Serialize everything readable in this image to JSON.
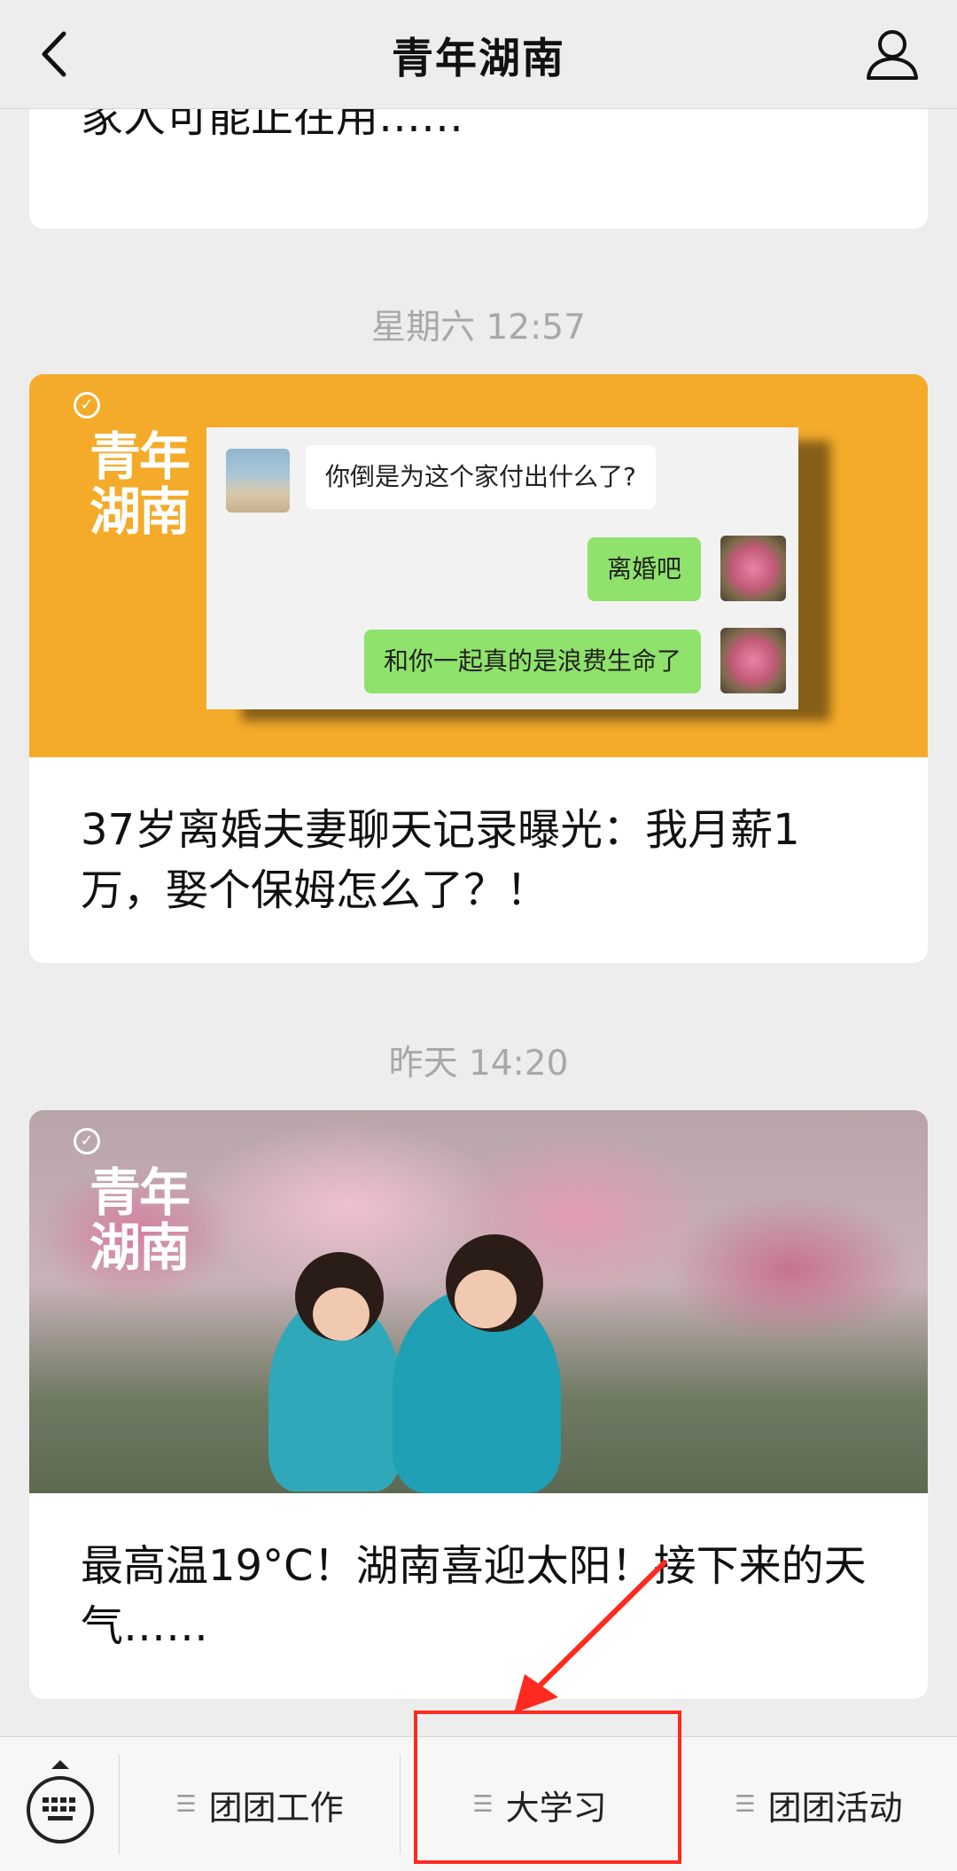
{
  "header": {
    "title": "青年湖南",
    "back_icon": "chevron-left-icon",
    "profile_icon": "person-icon"
  },
  "feed": {
    "partial_article": {
      "title": "家人可能正在用……"
    },
    "timestamp_1": "星期六 12:57",
    "article_1": {
      "brand_logo_text": "青年湖南",
      "chat": {
        "left_message": "你倒是为这个家付出什么了?",
        "right_message_1": "离婚吧",
        "right_message_2": "和你一起真的是浪费生命了"
      },
      "title": "37岁离婚夫妻聊天记录曝光：我月薪1万，娶个保姆怎么了？！"
    },
    "timestamp_2": "昨天 14:20",
    "article_2": {
      "brand_logo_text": "青年湖南",
      "title": "最高温19°C！湖南喜迎太阳！接下来的天气……"
    }
  },
  "menu": {
    "keyboard_icon": "keyboard-icon",
    "items": [
      {
        "label": "团团工作",
        "icon": "menu-lines-icon"
      },
      {
        "label": "大学习",
        "icon": "menu-lines-icon"
      },
      {
        "label": "团团活动",
        "icon": "menu-lines-icon"
      }
    ]
  },
  "annotation": {
    "highlight_color": "#ff2a1f",
    "highlighted_item": "大学习"
  },
  "colors": {
    "background": "#ededed",
    "cover_orange": "#f4ab2a",
    "chat_green": "#8fe26b"
  }
}
